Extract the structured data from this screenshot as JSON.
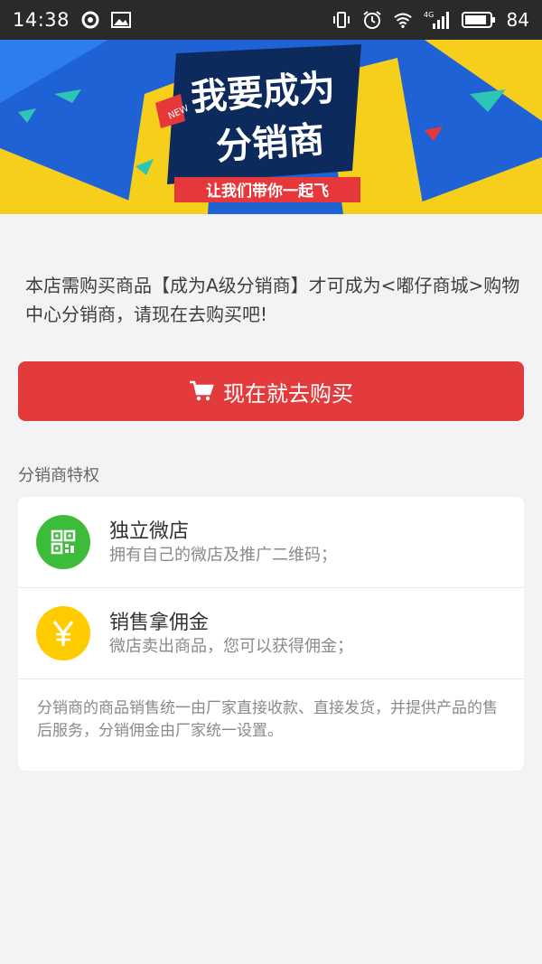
{
  "status_bar": {
    "time": "14:38",
    "battery": "84",
    "network": "4G"
  },
  "banner": {
    "line1": "我要成为",
    "line2": "分销商",
    "badge": "NEW",
    "slogan": "让我们带你一起飞"
  },
  "description": "本店需购买商品【成为A级分销商】才可成为<嘟仔商城>购物中心分销商，请现在去购买吧!",
  "buy_button": {
    "label": "现在就去购买",
    "icon": "cart-icon"
  },
  "privileges": {
    "section_title": "分销商特权",
    "items": [
      {
        "title": "独立微店",
        "subtitle": "拥有自己的微店及推广二维码；",
        "icon": "qr-code-icon",
        "color": "#3dbc3b"
      },
      {
        "title": "销售拿佣金",
        "subtitle": "微店卖出商品，您可以获得佣金；",
        "icon": "yen-icon",
        "color": "#ffcc00"
      }
    ],
    "note": "分销商的商品销售统一由厂家直接收款、直接发货，并提供产品的售后服务，分销佣金由厂家统一设置。"
  },
  "colors": {
    "accent_red": "#e33b3b",
    "green": "#3dbc3b",
    "yellow": "#ffcc00"
  }
}
